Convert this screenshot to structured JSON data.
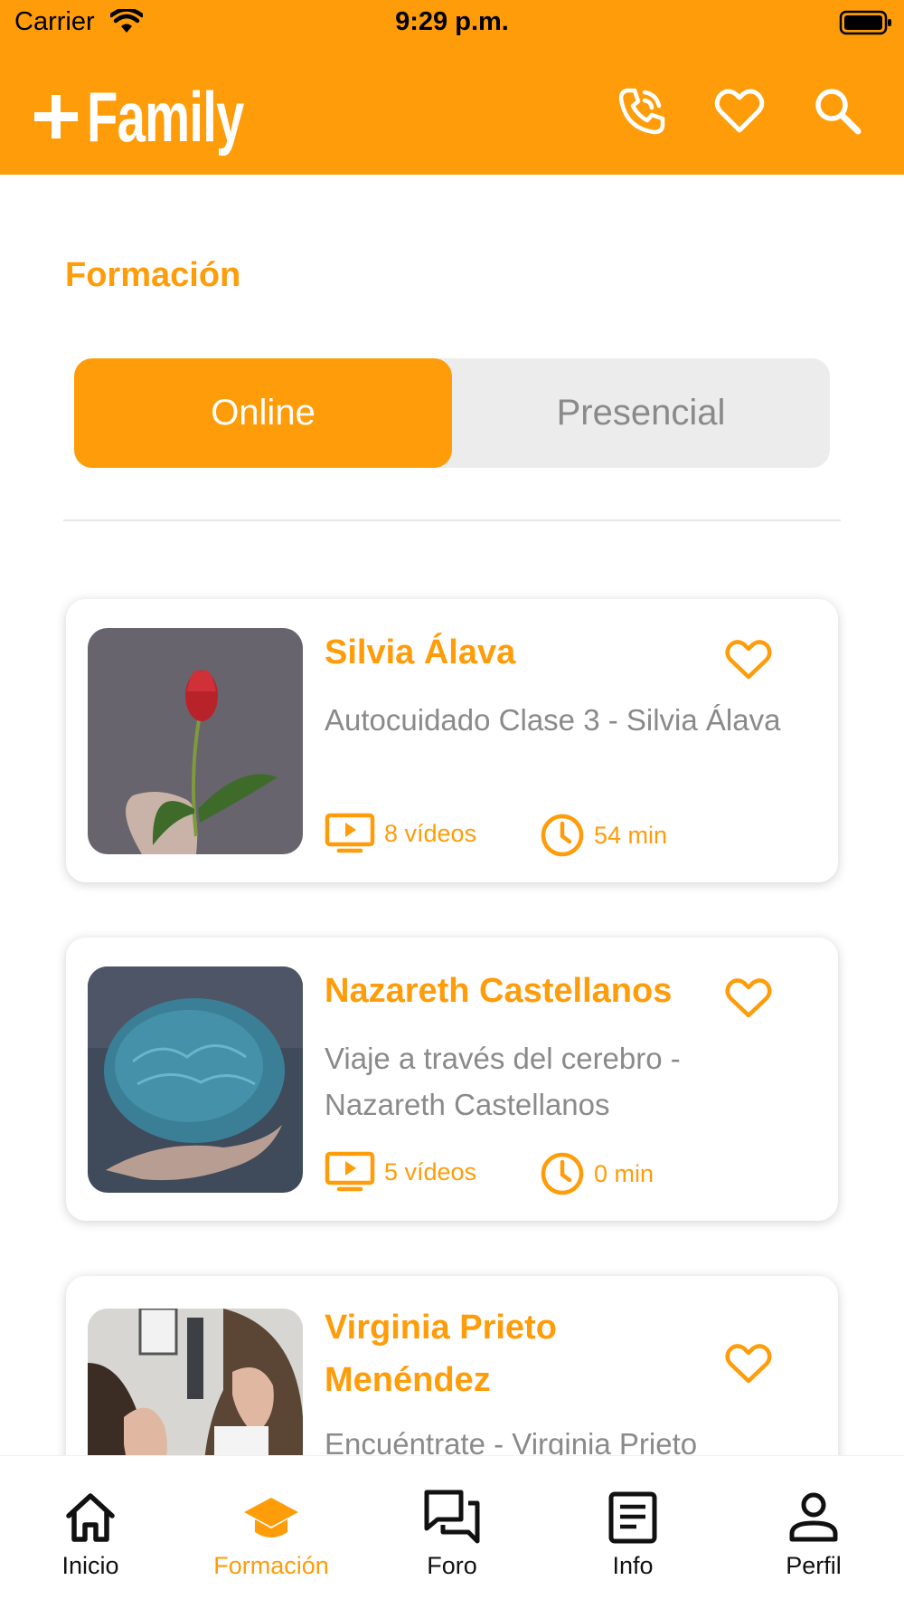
{
  "status_bar": {
    "carrier": "Carrier",
    "time": "9:29 p.m."
  },
  "header": {
    "logo": "Family",
    "icons": [
      "phone-icon",
      "heart-icon",
      "search-icon"
    ]
  },
  "page": {
    "title": "Formación"
  },
  "segmented": {
    "online_label": "Online",
    "presencial_label": "Presencial",
    "selected": "Online"
  },
  "courses": [
    {
      "name": "Silvia Álava",
      "description": "Autocuidado Clase 3 - Silvia Álava",
      "videos": "8 vídeos",
      "duration": "54 min"
    },
    {
      "name": "Nazareth Castellanos",
      "description": "Viaje a través del cerebro - Nazareth Castellanos",
      "videos": "5 vídeos",
      "duration": "0 min"
    },
    {
      "name": "Virginia Prieto Menéndez",
      "description": "Encuéntrate - Virginia Prieto"
    }
  ],
  "tabs": [
    {
      "label": "Inicio",
      "icon": "home-icon"
    },
    {
      "label": "Formación",
      "icon": "graduation-cap-icon"
    },
    {
      "label": "Foro",
      "icon": "chat-icon"
    },
    {
      "label": "Info",
      "icon": "document-icon"
    },
    {
      "label": "Perfil",
      "icon": "person-icon"
    }
  ],
  "colors": {
    "accent": "#FF9C09",
    "text_muted": "#8a8a8a",
    "segment_bg": "#ececec"
  }
}
